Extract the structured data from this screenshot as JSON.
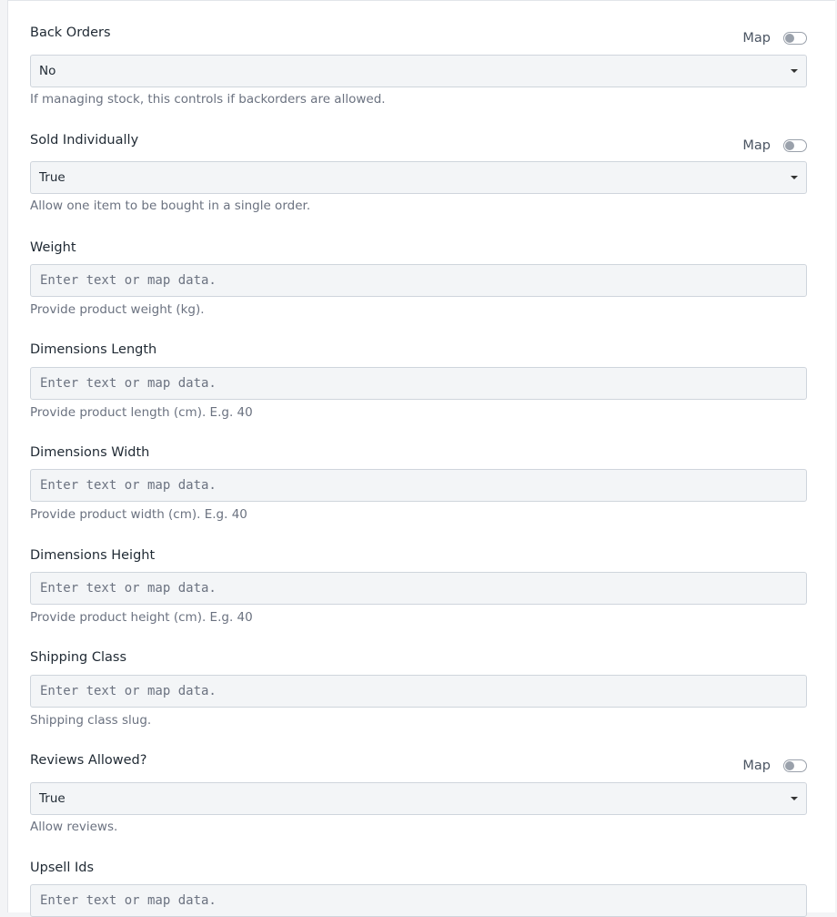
{
  "map_label": "Map",
  "fields": {
    "back_orders": {
      "label": "Back Orders",
      "value": "No",
      "help": "If managing stock, this controls if backorders are allowed."
    },
    "sold_individually": {
      "label": "Sold Individually",
      "value": "True",
      "help": "Allow one item to be bought in a single order."
    },
    "weight": {
      "label": "Weight",
      "placeholder": "Enter text or map data.",
      "help": "Provide product weight (kg)."
    },
    "dimensions_length": {
      "label": "Dimensions Length",
      "placeholder": "Enter text or map data.",
      "help": "Provide product length (cm). E.g. 40"
    },
    "dimensions_width": {
      "label": "Dimensions Width",
      "placeholder": "Enter text or map data.",
      "help": "Provide product width (cm). E.g. 40"
    },
    "dimensions_height": {
      "label": "Dimensions Height",
      "placeholder": "Enter text or map data.",
      "help": "Provide product height (cm). E.g. 40"
    },
    "shipping_class": {
      "label": "Shipping Class",
      "placeholder": "Enter text or map data.",
      "help": "Shipping class slug."
    },
    "reviews_allowed": {
      "label": "Reviews Allowed?",
      "value": "True",
      "help": "Allow reviews."
    },
    "upsell_ids": {
      "label": "Upsell Ids",
      "placeholder": "Enter text or map data."
    }
  }
}
